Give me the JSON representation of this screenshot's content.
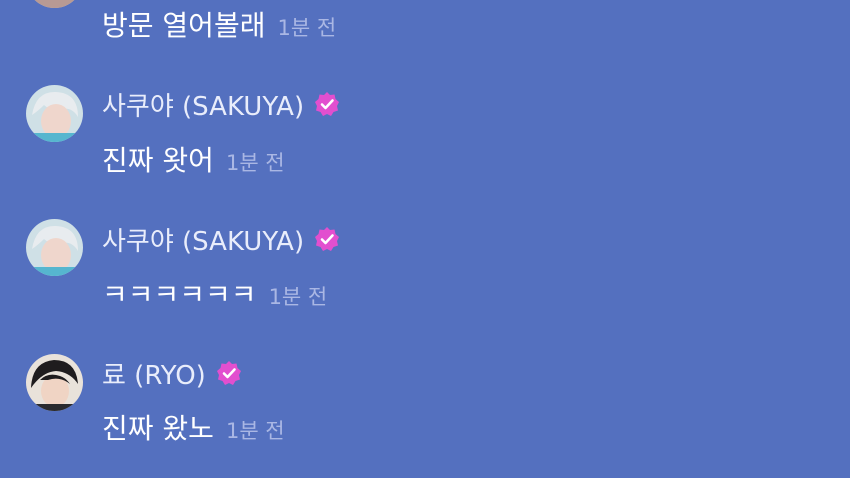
{
  "chat": {
    "messages": [
      {
        "sender": "",
        "text": "방문 열어볼래",
        "time": "1분 전"
      },
      {
        "sender": "사쿠야 (SAKUYA)",
        "verified_icon": "verified-badge-icon",
        "text": "진짜 왓어",
        "time": "1분 전"
      },
      {
        "sender": "사쿠야 (SAKUYA)",
        "verified_icon": "verified-badge-icon",
        "text": "ㅋㅋㅋㅋㅋㅋ",
        "time": "1분 전"
      },
      {
        "sender": "료 (RYO)",
        "verified_icon": "verified-badge-icon",
        "text": "진짜 왔노",
        "time": "1분 전"
      }
    ]
  },
  "colors": {
    "background": "#5470bf",
    "badge": "#e24fcf",
    "timestamp": "#aab7e4",
    "name": "#e9edfb"
  }
}
